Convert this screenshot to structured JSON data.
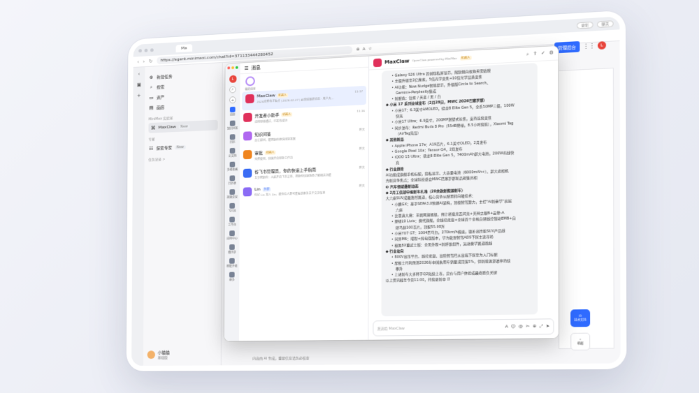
{
  "browser": {
    "tab_title": "Ma",
    "url": "https://agent.minimaxi.com/chat?id=371133444280452",
    "chip_1": "更新",
    "chip_2": "聊天",
    "bg_button": "管理后台",
    "bg_avatar": "L",
    "support_label": "技术支持",
    "collapse_label": "收起",
    "bottom_text": "内容由 AI 生成，重要信息请务必核查"
  },
  "sidebar": {
    "items": [
      {
        "icon": "plus-circle-icon",
        "label": "新建任务"
      },
      {
        "icon": "search-icon",
        "label": "搜索"
      },
      {
        "icon": "folder-icon",
        "label": "资产"
      },
      {
        "icon": "image-icon",
        "label": "画廊"
      }
    ],
    "section_1": "MiniMax 实验室",
    "lab_item": {
      "label": "MaxClaw",
      "tag": "New"
    },
    "section_2": "专家",
    "expert_item": {
      "label": "探索专家",
      "tag": "New"
    },
    "history": "任务记录 >",
    "user": {
      "name": "小猫猫",
      "sub": "基础版"
    }
  },
  "window": {
    "list_title": "消息",
    "pinned_label": "我的消息",
    "rail": {
      "avatar": "L",
      "items": [
        "消息",
        "知识问答",
        "日历",
        "云文档",
        "多维表格",
        "日历表",
        "视频会议",
        "飞行社",
        "工作台",
        "应用中心",
        "通讯录",
        "智能升级",
        "更多"
      ]
    },
    "conversations": [
      {
        "name": "MaxClaw",
        "badge": "机器人",
        "badge_type": "y",
        "time": "11:17",
        "sub": "2026消费电子看点 | 2026.02.27 | AI领域最新动态 · 用户大...",
        "color": "#e0315b"
      },
      {
        "name": "开发者小助手",
        "badge": "机器人",
        "badge_type": "y",
        "time": "11:16",
        "sub": "应用审核通过，已发布成功",
        "color": "#e0315b"
      },
      {
        "name": "知识问答",
        "badge": "",
        "badge_type": "",
        "time": "昨天",
        "sub": "向它提问，能帮助你更快找到答案",
        "color": "#b068f0"
      },
      {
        "name": "审批",
        "badge": "机器人",
        "badge_type": "y",
        "time": "昨天",
        "sub": "免费使用，快速开启审批工作流",
        "color": "#f0851e"
      },
      {
        "name": "谷飞书管理员，你的快速上手指南",
        "badge": "",
        "badge_type": "",
        "time": "昨天",
        "sub": "五步帮助你：从此开启飞书之旅，帮助你快速熟悉了解相关功能",
        "color": "#3b6df4"
      },
      {
        "name": "Lin",
        "badge": "外部",
        "badge_type": "b",
        "time": "昨天",
        "sub": "你好 Lin 加入 Lin。跟你在人群可能看到更多关于交流信息",
        "color": "#8b6cf5"
      }
    ],
    "chat": {
      "title": "MaxClaw",
      "subtitle": "OpenClaw powered by MiniMax",
      "badge": "机器人",
      "input_placeholder": "发送给 MaxClaw",
      "lines": [
        {
          "cls": "i1",
          "text": "• Galaxy S26 Ultra 首创隐私屏显示，限制侧向视角无需贴膜"
        },
        {
          "cls": "i1",
          "text": "• 主摄升级至2亿像素，5倍光学变焦+10倍光学品质变焦"
        },
        {
          "cls": "i1",
          "text": "• AI功能：Now Nudge智能提示，升级版Circle to Search、"
        },
        {
          "cls": "i2",
          "text": "Gemini+Perplexity集成"
        },
        {
          "cls": "i1",
          "text": "• 新配色：钴紫 / 天蓝 / 黑 / 白"
        },
        {
          "cls": "b",
          "text": "◆ 小米 17 系列全球发布（2月28日，MWC 2026巴塞罗那）"
        },
        {
          "cls": "i1",
          "text": "• 小米17：6.3英寸AMOLED，骁龙8 Elite Gen 5，全系50MP三摄，100W"
        },
        {
          "cls": "i2",
          "text": "快充"
        },
        {
          "cls": "i1",
          "text": "• 小米17 Ultra：6.9英寸，200MP潜望式长焦，支持连续变焦"
        },
        {
          "cls": "i1",
          "text": "• 同步发布：Redmi Buds 8 Pro（55dB降噪，8.5小时续航），Xiaomi Tag"
        },
        {
          "cls": "i2",
          "text": "（AirTag竞品）"
        },
        {
          "cls": "b",
          "text": "◆ 其他新品"
        },
        {
          "cls": "i1",
          "text": "• Apple iPhone 17e：A19芯片，6.1英寸OLED，2月发布"
        },
        {
          "cls": "i1",
          "text": "• Google Pixel 10a：Tensor G4，2月发布"
        },
        {
          "cls": "i1",
          "text": "• iQOO 15 Ultra：骁龙8 Elite Gen 5，7400mAh超大电池，200W有线快"
        },
        {
          "cls": "i2",
          "text": "充"
        },
        {
          "cls": "b",
          "text": "◆ 行业趋势"
        },
        {
          "cls": "",
          "text": "AI功能成旗舰手机标配，隐私显示、大容量电池（6000mAh+）、超大底相机"
        },
        {
          "cls": "",
          "text": "为新竞争焦点；全球科技盛会MWC巴塞罗那新品密集亮相"
        },
        {
          "cls": "",
          "text": " "
        },
        {
          "cls": "b",
          "text": "❸ 汽车领域最新动态"
        },
        {
          "cls": "b",
          "text": "◆ 2月工信部申报新车扎堆（20余款新能源新车）"
        },
        {
          "cls": "",
          "text": "大六座SUV成最激烈赛道，核心竞争从配置转向硬技术："
        },
        {
          "cls": "i1",
          "text": "• 小鹏GX：基于SEPA3.0物理AI架构，顶级智驾算力，主打\"AI新豪华\"高端"
        },
        {
          "cls": "i2",
          "text": "六座"
        },
        {
          "cls": "i1",
          "text": "• 比亚迪大唐：王朝网旗舰级，预计搭载兆瓦闪充+天神之眼B+云辇-A"
        },
        {
          "cls": "i1",
          "text": "• 理想L9 Livis：换代旗舰，全线控底盘+全球首个全栈自研线控制动EMB+自"
        },
        {
          "cls": "i2",
          "text": "研马赫100芯片，顶配55.98万"
        },
        {
          "cls": "i1",
          "text": "• 小米YU7 GT：1004匹马力，270km/h极速，填补高性能SUV产品线"
        },
        {
          "cls": "i1",
          "text": "• 问界M6：增程+纯电双版本，华为乾崑智驾ADS下探主流市场"
        },
        {
          "cls": "i1",
          "text": "• 极氪8X重武士版：全黑外观+新纤维组件，运动豪华赛道路线"
        },
        {
          "cls": "b",
          "text": "◆ 行业动向"
        },
        {
          "cls": "i1",
          "text": "• 800V高压平台、线控底盘、高阶智驾已从高端下探至为入门标配"
        },
        {
          "cls": "i1",
          "text": "• 摩根士丹利预测2026年中国乘用车销量或回落5%，但新能源渗透率持续"
        },
        {
          "cls": "i2",
          "text": "攀升"
        },
        {
          "cls": "i1",
          "text": "• 上述新车大多将于Q2陆续上市，定价与用户体验成最终胜负关键"
        },
        {
          "cls": "",
          "text": " "
        },
        {
          "cls": "",
          "text": "以上资讯截至今日11:00，持续更新中 ☑"
        }
      ]
    }
  }
}
